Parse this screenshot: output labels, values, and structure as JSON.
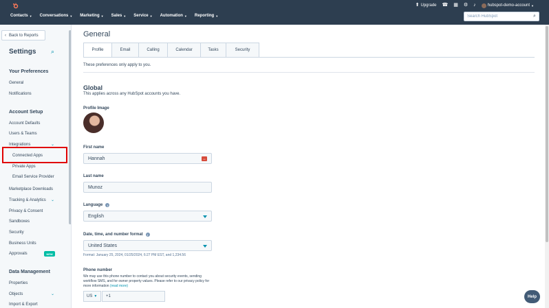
{
  "topnav": {
    "logo_glyph": "⚙",
    "upgrade_label": "Upgrade",
    "account_label": "hubspot-demo-account",
    "menu": [
      "Contacts",
      "Conversations",
      "Marketing",
      "Sales",
      "Service",
      "Automation",
      "Reporting"
    ],
    "search_placeholder": "Search HubSpot"
  },
  "sidebar": {
    "back_label": "Back to Reports",
    "title": "Settings",
    "sections": {
      "preferences": "Your Preferences",
      "account_setup": "Account Setup",
      "data_management": "Data Management"
    },
    "preferences_items": [
      "General",
      "Notifications"
    ],
    "account_items": [
      "Account Defaults",
      "Users & Teams",
      "Integrations",
      "Connected Apps",
      "Private Apps",
      "Email Service Provider",
      "Marketplace Downloads",
      "Tracking & Analytics",
      "Privacy & Consent",
      "Sandboxes",
      "Security",
      "Business Units",
      "Approvals"
    ],
    "new_badge": "NEW",
    "data_items": [
      "Properties",
      "Objects",
      "Import & Export"
    ]
  },
  "main": {
    "title": "General",
    "tabs": [
      "Profile",
      "Email",
      "Calling",
      "Calendar",
      "Tasks",
      "Security"
    ],
    "intro": "These preferences only apply to you.",
    "global_heading": "Global",
    "global_desc": "This applies across any HubSpot accounts you have.",
    "profile_image_label": "Profile Image",
    "first_name_label": "First name",
    "first_name_value": "Hannah",
    "last_name_label": "Last name",
    "last_name_value": "Munoz",
    "language_label": "Language",
    "language_value": "English",
    "format_label": "Date, time, and number format",
    "format_value": "United States",
    "format_note": "Format: January 25, 2024, 01/25/2024, 6:27 PM EST, and 1,234.56",
    "phone_label": "Phone number",
    "phone_desc": "We may use this phone number to contact you about security events, sending workflow SMS, and for owner property values. Please refer to our privacy policy for more information",
    "phone_link": "(read more)",
    "country_code": "US",
    "phone_prefix": "+1",
    "help_label": "Help"
  }
}
